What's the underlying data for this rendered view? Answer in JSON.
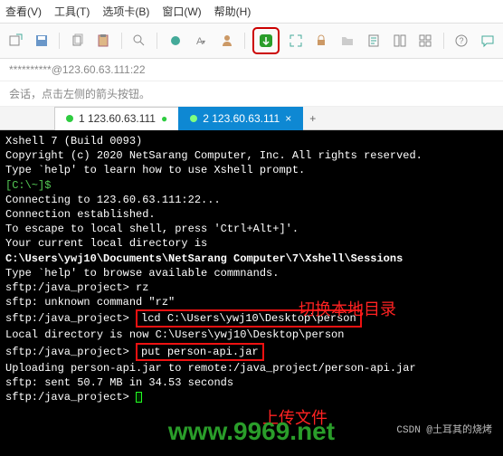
{
  "menu": {
    "view": "查看(V)",
    "tools": "工具(T)",
    "tabs": "选项卡(B)",
    "window": "窗口(W)",
    "help": "帮助(H)"
  },
  "address": "**********@123.60.63.111:22",
  "hint": "会话，点击左侧的箭头按钮。",
  "sidebar_ip": ".111",
  "tabs": {
    "inactive": "1 123.60.63.111",
    "inactive_dot": "●",
    "active": "2 123.60.63.111",
    "add": "+"
  },
  "term": {
    "l1": "Xshell 7 (Build 0093)",
    "l2": "Copyright (c) 2020 NetSarang Computer, Inc. All rights reserved.",
    "l3": "",
    "l4": "Type `help' to learn how to use Xshell prompt.",
    "l5a": "[C:\\~]$",
    "l5b": " ",
    "l6": "",
    "l7": "Connecting to 123.60.63.111:22...",
    "l8": "Connection established.",
    "l9": "To escape to local shell, press 'Ctrl+Alt+]'.",
    "l10": "",
    "l11": "Your current local directory is",
    "l12": "C:\\Users\\ywj10\\Documents\\NetSarang Computer\\7\\Xshell\\Sessions",
    "l13": "",
    "l14": "Type `help' to browse available commnands.",
    "l15a": "sftp:/java_project> ",
    "l15b": "rz",
    "l16": "sftp: unknown command \"rz\"",
    "l17a": "sftp:/java_project> ",
    "l17b": "lcd C:\\Users\\ywj10\\Desktop\\person",
    "l18": "Local directory is now C:\\Users\\ywj10\\Desktop\\person",
    "l19a": "sftp:/java_project> ",
    "l19b": "put person-api.jar",
    "l20": "Uploading person-api.jar to remote:/java_project/person-api.jar",
    "l21": "sftp: sent 50.7 MB in 34.53 seconds",
    "l22": "sftp:/java_project> "
  },
  "anno": {
    "switch_dir": "切换本地目录",
    "upload": "上传文件"
  },
  "watermark": "www.9969.net",
  "csdn": "CSDN @土耳其的烧烤"
}
